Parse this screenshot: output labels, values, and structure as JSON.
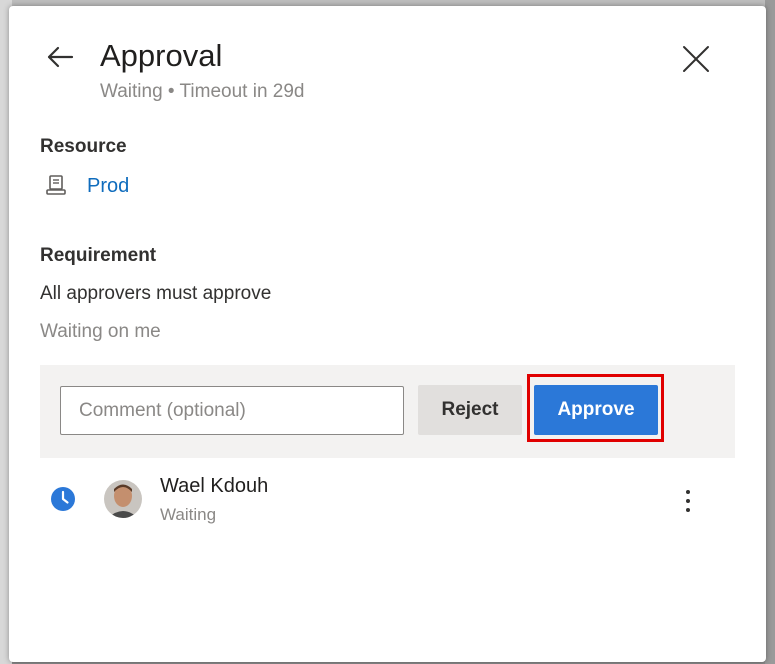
{
  "header": {
    "title": "Approval",
    "subtitle": "Waiting • Timeout in 29d"
  },
  "resource": {
    "label": "Resource",
    "name": "Prod",
    "icon": "server-icon"
  },
  "requirement": {
    "label": "Requirement",
    "text": "All approvers must approve",
    "waiting_text": "Waiting on me"
  },
  "actions": {
    "comment_placeholder": "Comment (optional)",
    "comment_value": "",
    "reject_label": "Reject",
    "approve_label": "Approve"
  },
  "approvers": [
    {
      "name": "Wael Kdouh",
      "status": "Waiting",
      "status_icon": "clock-icon"
    }
  ],
  "colors": {
    "accent": "#2b78d8",
    "link": "#0f6cbd",
    "highlight": "#e00000",
    "status_waiting": "#2b78d8"
  }
}
